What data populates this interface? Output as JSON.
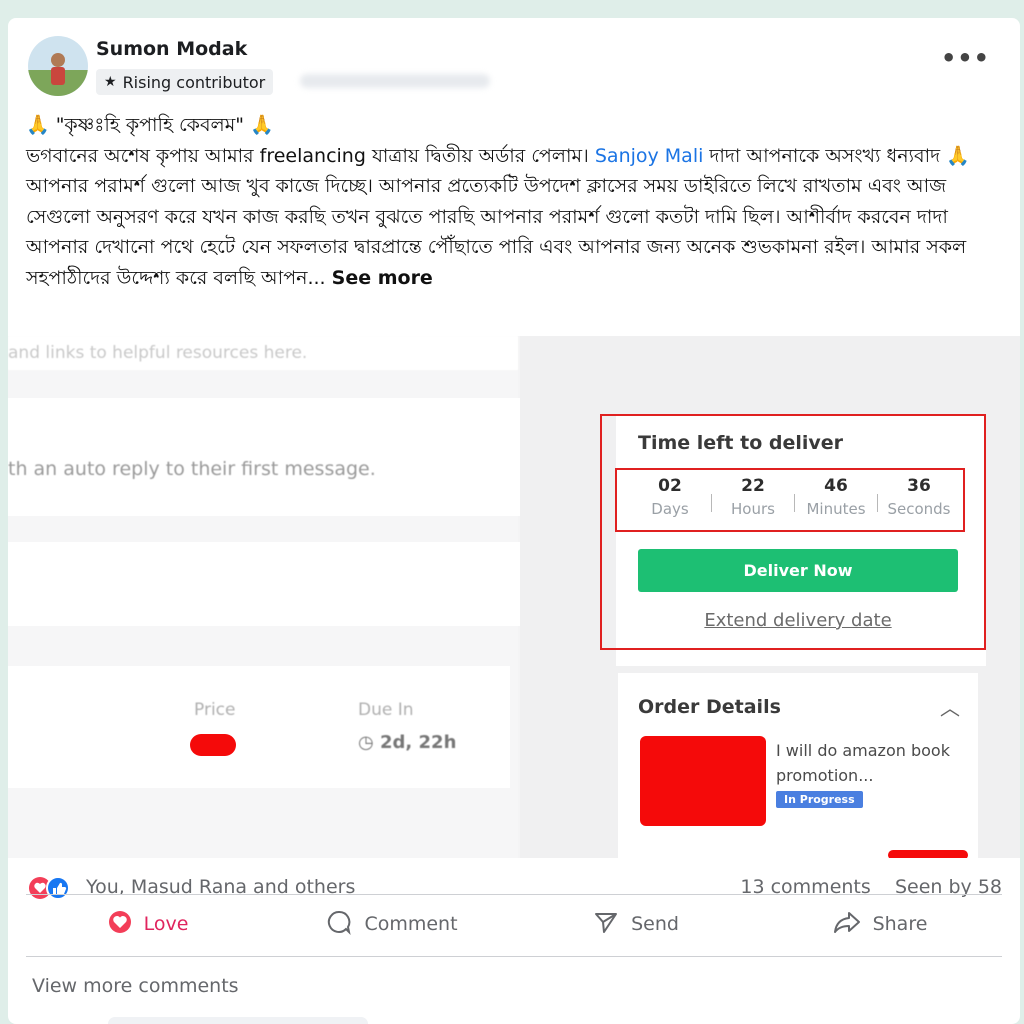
{
  "post": {
    "author": "Sumon Modak",
    "badge": "Rising contributor",
    "more_label": "•••",
    "line1": "🙏 \"কৃষ্ণঃহি কৃপাহি কেবলম\" 🙏",
    "body_pre": "ভগবানের অশেষ কৃপায় আমার freelancing যাত্রায় দ্বিতীয় অর্ডার পেলাম। ",
    "mention": "Sanjoy Mali",
    "body_post": " দাদা আপনাকে অসংখ্য ধন্যবাদ 🙏 আপনার পরামর্শ গুলো আজ খুব কাজে দিচ্ছে। আপনার প্রত্যেকটি উপদেশ ক্লাসের সময় ডাইরিতে লিখে রাখতাম এবং আজ সেগুলো অনুসরণ করে যখন কাজ করছি তখন বুঝতে পারছি আপনার পরামর্শ গুলো কতটা দামি ছিল। আশীর্বাদ করবেন দাদা আপনার দেখানো পথে হেটে যেন সফলতার দ্বারপ্রান্তে পৌঁছাতে পারি এবং আপনার জন্য অনেক শুভকামনা রইল। আমার সকল সহপাঠীদের উদ্দেশ্য করে বলছি আপন...",
    "see_more": "See more"
  },
  "screenshot": {
    "top_strip": "and links to helpful resources here.",
    "auto_reply": "th an auto reply to their first message.",
    "price_label": "Price",
    "due_label": "Due In",
    "due_value": "2d, 22h",
    "time_left": {
      "title": "Time left to deliver",
      "countdown": [
        {
          "num": "02",
          "unit": "Days"
        },
        {
          "num": "22",
          "unit": "Hours"
        },
        {
          "num": "46",
          "unit": "Minutes"
        },
        {
          "num": "36",
          "unit": "Seconds"
        }
      ],
      "deliver_button": "Deliver Now",
      "extend_link": "Extend delivery date"
    },
    "order": {
      "title": "Order Details",
      "description": "I will do amazon book promotion...",
      "status": "In Progress"
    },
    "colors": {
      "accent_green": "#1dbf73",
      "highlight_red": "#e02020",
      "status_blue": "#4a7fe0"
    }
  },
  "footer": {
    "reactions_text": "You, Masud Rana and others",
    "comments": "13 comments",
    "seen_by": "Seen by 58",
    "actions": {
      "love": "Love",
      "comment": "Comment",
      "send": "Send",
      "share": "Share"
    },
    "view_more": "View more comments"
  }
}
